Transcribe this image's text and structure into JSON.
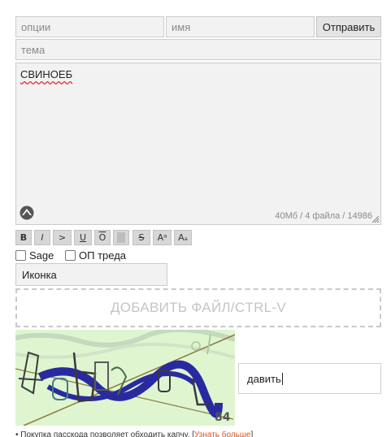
{
  "form": {
    "options_placeholder": "опции",
    "name_placeholder": "имя",
    "send_label": "Отправить",
    "subject_placeholder": "тема",
    "message_text": "СВИНОЕБ",
    "limits_text": "40Мб / 4 файла / 14986"
  },
  "markup_buttons": [
    {
      "label": "B",
      "icon": "bold-icon"
    },
    {
      "label": "I",
      "icon": "italic-icon"
    },
    {
      "label": ">",
      "icon": "quote-icon"
    },
    {
      "label": "U",
      "icon": "underline-icon"
    },
    {
      "label": "O",
      "icon": "overline-icon"
    },
    {
      "label": "",
      "icon": "spoiler-icon"
    },
    {
      "label": "S",
      "icon": "strike-icon"
    },
    {
      "label": "Aᵃ",
      "icon": "superscript-icon"
    },
    {
      "label": "Aₐ",
      "icon": "subscript-icon"
    }
  ],
  "checkboxes": {
    "sage_label": "Sage",
    "op_label": "ОП треда"
  },
  "icon_select": {
    "value": "Иконка"
  },
  "dropzone": {
    "label": "ДОБАВИТЬ ФАЙЛ/CTRL-V"
  },
  "captcha": {
    "value": "давить",
    "number": "84",
    "colors": {
      "background": "#dff5d0",
      "accent": "#2a2aa0"
    }
  },
  "footer": {
    "text": "• Покупка пасскода позволяет обходить капчу. [",
    "link": "Узнать больше",
    "end": "]"
  }
}
